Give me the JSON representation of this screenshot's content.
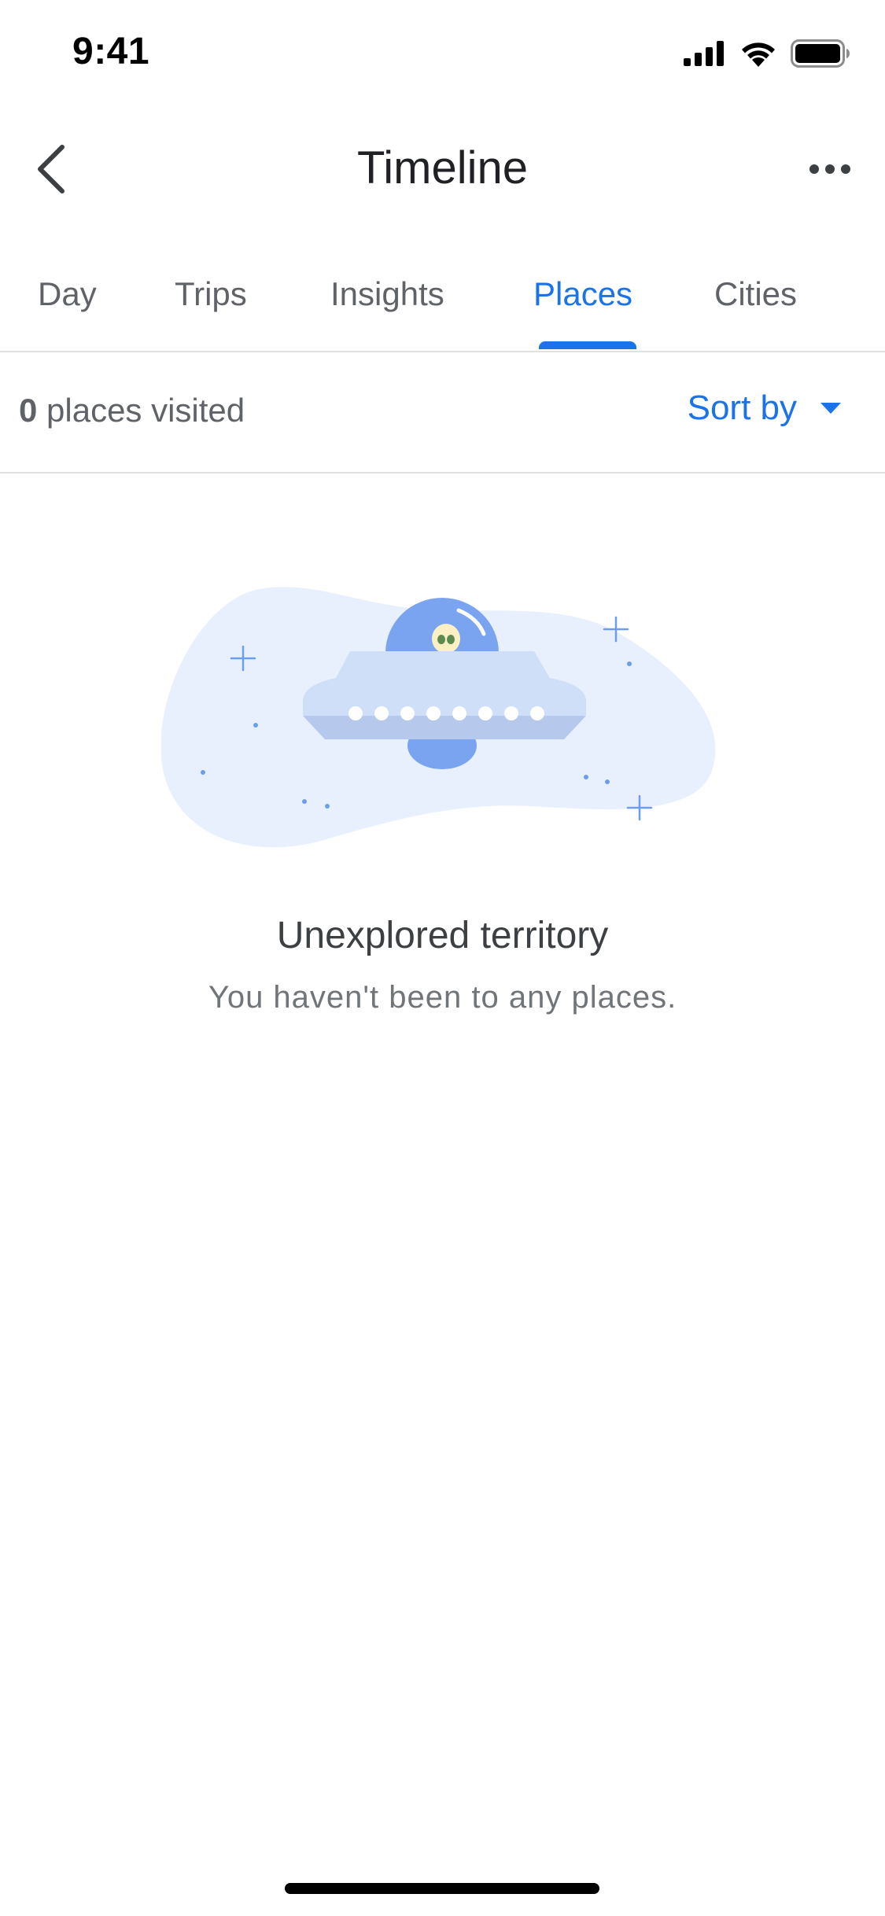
{
  "status_bar": {
    "time": "9:41"
  },
  "header": {
    "title": "Timeline",
    "back_icon": "chevron-left-icon",
    "more_icon": "more-horizontal-icon"
  },
  "tabs": [
    {
      "label": "Day",
      "active": false
    },
    {
      "label": "Trips",
      "active": false
    },
    {
      "label": "Insights",
      "active": false
    },
    {
      "label": "Places",
      "active": true
    },
    {
      "label": "Cities",
      "active": false
    }
  ],
  "summary": {
    "count": "0",
    "count_suffix": " places visited",
    "sort_label": "Sort by",
    "sort_icon": "caret-down-icon"
  },
  "empty_state": {
    "title": "Unexplored territory",
    "subtitle": "You haven't been to any places."
  },
  "colors": {
    "accent": "#1a73e8",
    "text_primary": "#202124",
    "text_secondary": "#5f6368",
    "divider": "#e0e0e0",
    "illustration_bg": "#e8f0fe"
  }
}
